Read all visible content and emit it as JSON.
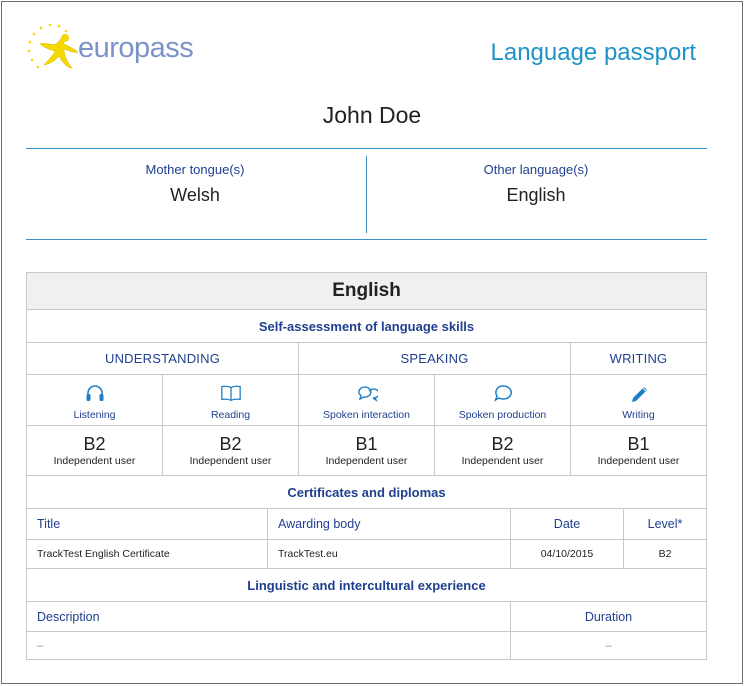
{
  "header": {
    "logo_text": "europass",
    "doc_title": "Language passport"
  },
  "person": {
    "name": "John Doe"
  },
  "languages": {
    "mother_label": "Mother tongue(s)",
    "mother_value": "Welsh",
    "other_label": "Other language(s)",
    "other_value": "English"
  },
  "assessment": {
    "language": "English",
    "section_title": "Self-assessment of language skills",
    "categories": [
      "UNDERSTANDING",
      "SPEAKING",
      "WRITING"
    ],
    "skills": [
      {
        "label": "Listening",
        "icon": "headphones-icon",
        "grade": "B2",
        "desc": "Independent user"
      },
      {
        "label": "Reading",
        "icon": "book-icon",
        "grade": "B2",
        "desc": "Independent user"
      },
      {
        "label": "Spoken interaction",
        "icon": "chat-bubbles-icon",
        "grade": "B1",
        "desc": "Independent user"
      },
      {
        "label": "Spoken production",
        "icon": "speech-bubble-icon",
        "grade": "B2",
        "desc": "Independent user"
      },
      {
        "label": "Writing",
        "icon": "pencil-icon",
        "grade": "B1",
        "desc": "Independent user"
      }
    ],
    "icon_color": "#1f7fc4"
  },
  "certificates": {
    "title": "Certificates and diplomas",
    "headers": [
      "Title",
      "Awarding body",
      "Date",
      "Level*"
    ],
    "rows": [
      [
        "TrackTest English Certificate",
        "TrackTest.eu",
        "04/10/2015",
        "B2"
      ]
    ]
  },
  "experience": {
    "title": "Linguistic and intercultural experience",
    "headers": [
      "Description",
      "Duration"
    ],
    "rows": [
      [
        "–",
        "–"
      ]
    ]
  },
  "colors": {
    "accent": "#1f92c8",
    "label_blue": "#1f3f8f",
    "logo_blue": "#7b93c8",
    "star_yellow": "#f5d800"
  }
}
